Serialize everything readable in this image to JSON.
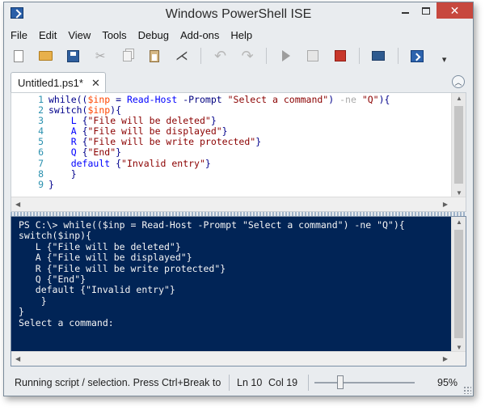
{
  "window": {
    "title": "Windows PowerShell ISE",
    "controls": {
      "minimize": "",
      "maximize": "",
      "close": "✕"
    }
  },
  "menu": [
    "File",
    "Edit",
    "View",
    "Tools",
    "Debug",
    "Add-ons",
    "Help"
  ],
  "toolbar": {
    "icons": [
      "new-script-icon",
      "open-icon",
      "save-icon",
      "cut-icon",
      "copy-icon",
      "paste-icon",
      "clear-console-icon",
      "undo-icon",
      "redo-icon",
      "run-script-icon",
      "run-selection-icon",
      "stop-icon",
      "new-remote-tab-icon",
      "powershell-console-icon",
      "toolbar-overflow-icon"
    ]
  },
  "tab": {
    "label": "Untitled1.ps1*",
    "close": "✕",
    "collapse": "︿"
  },
  "editor": {
    "line_numbers": [
      "1",
      "2",
      "3",
      "4",
      "5",
      "6",
      "7",
      "8",
      "9"
    ],
    "lines": [
      [
        [
          "kw",
          "while(("
        ],
        [
          "var",
          "$inp"
        ],
        [
          "txt",
          " = "
        ],
        [
          "cmd",
          "Read-Host"
        ],
        [
          "txt",
          " "
        ],
        [
          "param",
          "-Prompt"
        ],
        [
          "txt",
          " "
        ],
        [
          "str",
          "\"Select a command\""
        ],
        [
          "txt",
          ") "
        ],
        [
          "op",
          "-ne"
        ],
        [
          "txt",
          " "
        ],
        [
          "str",
          "\"Q\""
        ],
        [
          "txt",
          "){"
        ]
      ],
      [
        [
          "kw",
          "switch("
        ],
        [
          "var",
          "$inp"
        ],
        [
          "txt",
          "){"
        ]
      ],
      [
        [
          "txt",
          "    "
        ],
        [
          "cmd",
          "L"
        ],
        [
          "txt",
          " {"
        ],
        [
          "str",
          "\"File will be deleted\""
        ],
        [
          "txt",
          "}"
        ]
      ],
      [
        [
          "txt",
          "    "
        ],
        [
          "cmd",
          "A"
        ],
        [
          "txt",
          " {"
        ],
        [
          "str",
          "\"File will be displayed\""
        ],
        [
          "txt",
          "}"
        ]
      ],
      [
        [
          "txt",
          "    "
        ],
        [
          "cmd",
          "R"
        ],
        [
          "txt",
          " {"
        ],
        [
          "str",
          "\"File will be write protected\""
        ],
        [
          "txt",
          "}"
        ]
      ],
      [
        [
          "txt",
          "    "
        ],
        [
          "cmd",
          "Q"
        ],
        [
          "txt",
          " {"
        ],
        [
          "str",
          "\"End\""
        ],
        [
          "txt",
          "}"
        ]
      ],
      [
        [
          "txt",
          "    "
        ],
        [
          "cmd",
          "default"
        ],
        [
          "txt",
          " {"
        ],
        [
          "str",
          "\"Invalid entry\""
        ],
        [
          "txt",
          "}"
        ]
      ],
      [
        [
          "txt",
          "    }"
        ]
      ],
      [
        [
          "txt",
          "}"
        ]
      ]
    ]
  },
  "console": {
    "lines": [
      "PS C:\\> while(($inp = Read-Host -Prompt \"Select a command\") -ne \"Q\"){",
      "switch($inp){",
      "   L {\"File will be deleted\"}",
      "   A {\"File will be displayed\"}",
      "   R {\"File will be write protected\"}",
      "   Q {\"End\"}",
      "   default {\"Invalid entry\"}",
      "    }",
      "}",
      "Select a command:"
    ]
  },
  "status": {
    "message": "Running script / selection.  Press Ctrl+Break to",
    "line": "Ln 10",
    "column": "Col 19",
    "zoom": "95%",
    "zoom_level": 0.26
  }
}
